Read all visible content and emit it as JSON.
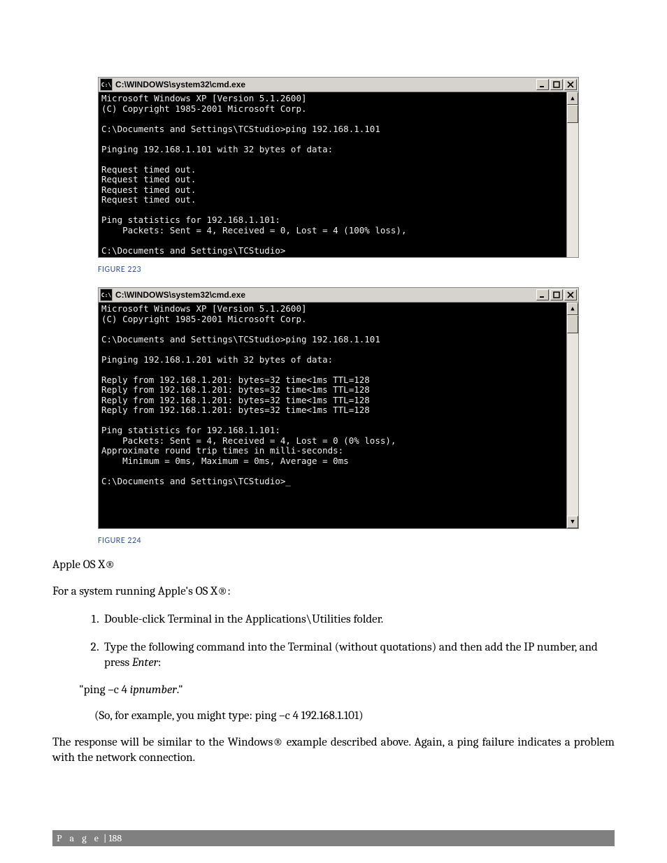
{
  "cmd1": {
    "title": "C:\\WINDOWS\\system32\\cmd.exe",
    "icon_text": "C:\\",
    "lines": "Microsoft Windows XP [Version 5.1.2600]\n(C) Copyright 1985-2001 Microsoft Corp.\n\nC:\\Documents and Settings\\TCStudio>ping 192.168.1.101\n\nPinging 192.168.1.101 with 32 bytes of data:\n\nRequest timed out.\nRequest timed out.\nRequest timed out.\nRequest timed out.\n\nPing statistics for 192.168.1.101:\n    Packets: Sent = 4, Received = 0, Lost = 4 (100% loss),\n\nC:\\Documents and Settings\\TCStudio>\n"
  },
  "figcap1": "FIGURE 223",
  "cmd2": {
    "title": "C:\\WINDOWS\\system32\\cmd.exe",
    "icon_text": "C:\\",
    "lines": "Microsoft Windows XP [Version 5.1.2600]\n(C) Copyright 1985-2001 Microsoft Corp.\n\nC:\\Documents and Settings\\TCStudio>ping 192.168.1.101\n\nPinging 192.168.1.201 with 32 bytes of data:\n\nReply from 192.168.1.201: bytes=32 time<1ms TTL=128\nReply from 192.168.1.201: bytes=32 time<1ms TTL=128\nReply from 192.168.1.201: bytes=32 time<1ms TTL=128\nReply from 192.168.1.201: bytes=32 time<1ms TTL=128\n\nPing statistics for 192.168.1.101:\n    Packets: Sent = 4, Received = 4, Lost = 0 (0% loss),\nApproximate round trip times in milli-seconds:\n    Minimum = 0ms, Maximum = 0ms, Average = 0ms\n\nC:\\Documents and Settings\\TCStudio>_\n\n\n\n\n"
  },
  "figcap2": "FIGURE 224",
  "heading": "Apple OS X®",
  "intro": "For a system running Apple's OS X®:",
  "step1": "Double-click Terminal in the Applications\\Utilities folder.",
  "step2_a": "Type the following command into the Terminal (without quotations) and then add the IP number, and press ",
  "step2_em": "Enter",
  "step2_b": ":",
  "ping_cmd_a": "\"ping –c 4 ",
  "ping_cmd_em": "ipnumber",
  "ping_cmd_b": ".\"",
  "example": "(So, for example, you might type:    ping –c 4 192.168.1.101)",
  "closing": "The response will be similar to the Windows® example described above.  Again, a ping failure indicates a problem with the network connection.",
  "footer_label": "P a g e",
  "footer_sep": "  |  ",
  "footer_page": "188"
}
